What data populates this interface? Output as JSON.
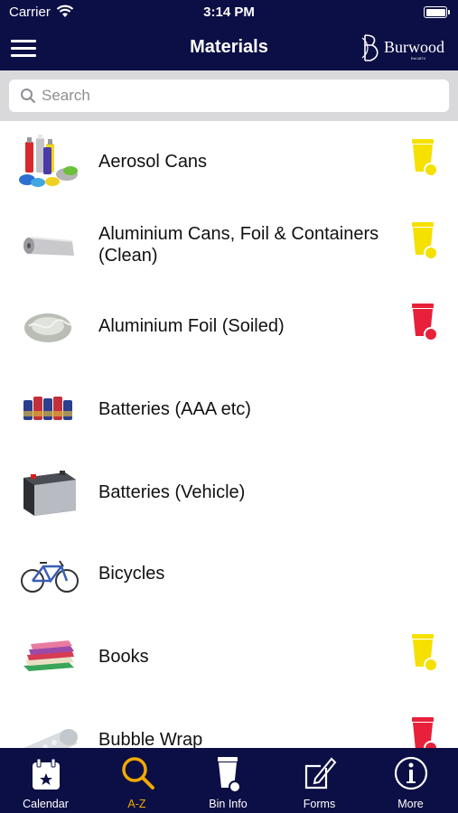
{
  "status_bar": {
    "carrier": "Carrier",
    "time": "3:14 PM"
  },
  "header": {
    "title": "Materials",
    "logo_text": "Burwood",
    "logo_subtext": "Est.1874"
  },
  "search": {
    "placeholder": "Search"
  },
  "bin_colors": {
    "yellow": "#f5e000",
    "red": "#e8203a"
  },
  "materials": [
    {
      "name": "Aerosol Cans",
      "icon": "aerosol-cans-icon",
      "bin": "yellow"
    },
    {
      "name": "Aluminium Cans, Foil & Containers (Clean)",
      "icon": "aluminium-foil-roll-icon",
      "bin": "yellow"
    },
    {
      "name": "Aluminium Foil (Soiled)",
      "icon": "soiled-foil-icon",
      "bin": "red"
    },
    {
      "name": "Batteries (AAA etc)",
      "icon": "batteries-icon",
      "bin": "none"
    },
    {
      "name": "Batteries (Vehicle)",
      "icon": "car-battery-icon",
      "bin": "none"
    },
    {
      "name": "Bicycles",
      "icon": "bicycle-icon",
      "bin": "none"
    },
    {
      "name": "Books",
      "icon": "books-icon",
      "bin": "yellow"
    },
    {
      "name": "Bubble Wrap",
      "icon": "bubble-wrap-icon",
      "bin": "red"
    }
  ],
  "tabs": [
    {
      "label": "Calendar",
      "icon": "calendar-icon",
      "active": false
    },
    {
      "label": "A-Z",
      "icon": "magnifier-icon",
      "active": true
    },
    {
      "label": "Bin Info",
      "icon": "wheelie-bin-icon",
      "active": false
    },
    {
      "label": "Forms",
      "icon": "edit-form-icon",
      "active": false
    },
    {
      "label": "More",
      "icon": "info-icon",
      "active": false
    }
  ],
  "colors": {
    "nav_background": "#0c0f45",
    "active_tab": "#f2a900"
  }
}
